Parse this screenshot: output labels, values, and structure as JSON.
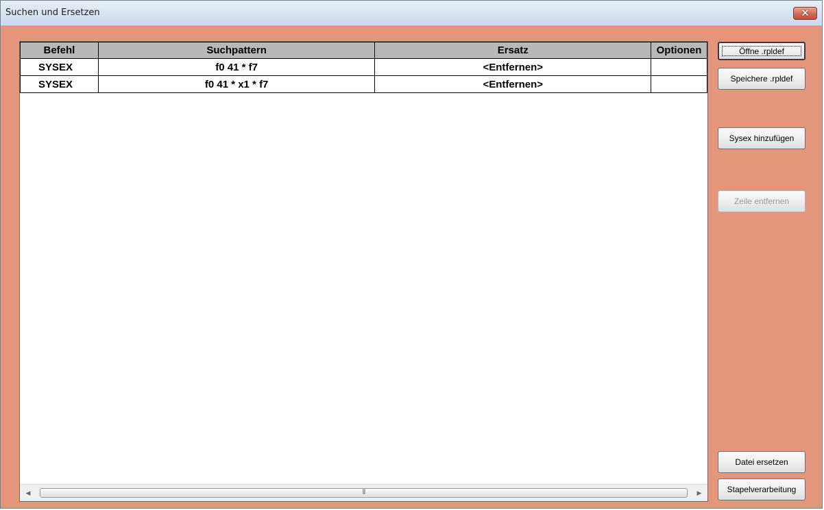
{
  "window": {
    "title": "Suchen und Ersetzen",
    "close_glyph": "✕"
  },
  "table": {
    "columns": [
      "Befehl",
      "Suchpattern",
      "Ersatz",
      "Optionen"
    ],
    "rows": [
      {
        "befehl": "SYSEX",
        "suchpattern": "f0 41 * f7",
        "ersatz": "<Entfernen>",
        "optionen": ""
      },
      {
        "befehl": "SYSEX",
        "suchpattern": "f0 41 * x1 * f7",
        "ersatz": "<Entfernen>",
        "optionen": ""
      }
    ]
  },
  "scrollbar": {
    "left_arrow": "◀",
    "right_arrow": "▶",
    "grip": "⦀"
  },
  "buttons": {
    "open": "Öffne .rpldef",
    "save": "Speichere .rpldef",
    "add_sysex": "Sysex hinzufügen",
    "remove_row": "Zeile entfernen",
    "replace_file": "Datei ersetzen",
    "batch": "Stapelverarbeitung"
  },
  "colors": {
    "dialog_bg": "#e4967a",
    "header_bg": "#b8b8b8",
    "close_button": "#c1503c"
  }
}
